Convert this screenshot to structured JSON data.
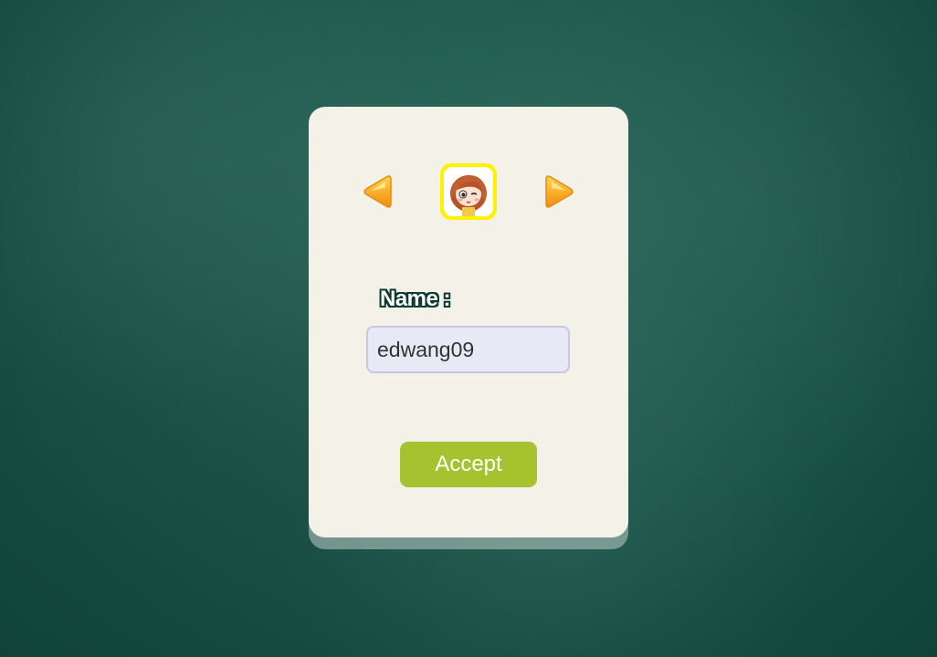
{
  "background": {
    "color": "#1f5a4d"
  },
  "avatar_selector": {
    "prev_icon": "arrow-left-icon",
    "next_icon": "arrow-right-icon",
    "avatar_icon": "girl-avatar-icon",
    "arrow_color": "#f7a81b",
    "avatar_frame_color": "#fff200"
  },
  "form": {
    "name_label": "Name :",
    "name_value": "edwang09"
  },
  "actions": {
    "accept_label": "Accept",
    "accept_color": "#a6c22f"
  }
}
